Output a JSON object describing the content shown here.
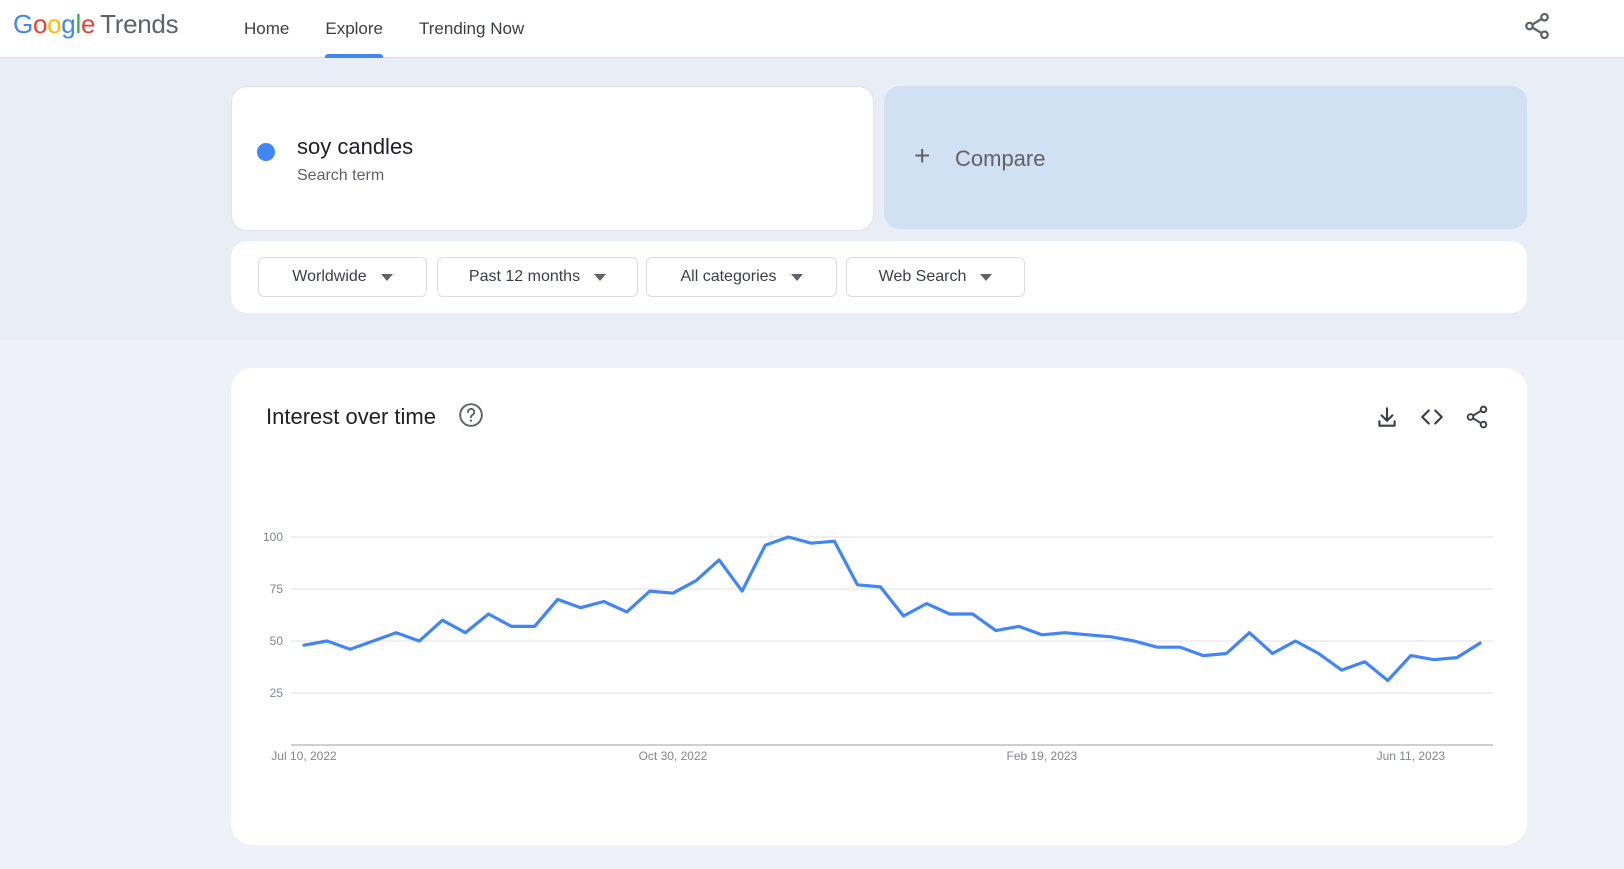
{
  "header": {
    "logo_google": [
      "G",
      "o",
      "o",
      "g",
      "l",
      "e"
    ],
    "logo_product": "Trends",
    "nav": [
      {
        "label": "Home",
        "active": false
      },
      {
        "label": "Explore",
        "active": true
      },
      {
        "label": "Trending Now",
        "active": false
      }
    ],
    "share_icon": "share-icon"
  },
  "search_term": {
    "title": "soy candles",
    "subtitle": "Search term",
    "color": "#4285f4"
  },
  "compare": {
    "plus": "+",
    "label": "Compare"
  },
  "filters": [
    {
      "label": "Worldwide"
    },
    {
      "label": "Past 12 months"
    },
    {
      "label": "All categories"
    },
    {
      "label": "Web Search"
    }
  ],
  "chart_card": {
    "title": "Interest over time",
    "icons": [
      "help-icon",
      "download-icon",
      "embed-icon",
      "share-icon"
    ]
  },
  "chart_data": {
    "type": "line",
    "ylim": [
      0,
      100
    ],
    "y_ticks": [
      25,
      50,
      75,
      100
    ],
    "x_tick_labels": [
      "Jul 10, 2022",
      "Oct 30, 2022",
      "Feb 19, 2023",
      "Jun 11, 2023"
    ],
    "x_tick_indices": [
      0,
      16,
      32,
      48
    ],
    "grid": true,
    "series": [
      {
        "color": "#4285f4",
        "values": [
          48,
          50,
          46,
          50,
          54,
          50,
          60,
          54,
          63,
          57,
          57,
          70,
          66,
          69,
          64,
          74,
          73,
          79,
          89,
          74,
          96,
          100,
          97,
          98,
          77,
          76,
          62,
          68,
          63,
          63,
          55,
          57,
          53,
          54,
          53,
          52,
          50,
          47,
          47,
          43,
          44,
          54,
          44,
          50,
          44,
          36,
          40,
          31,
          43,
          41,
          42,
          49
        ]
      }
    ]
  }
}
